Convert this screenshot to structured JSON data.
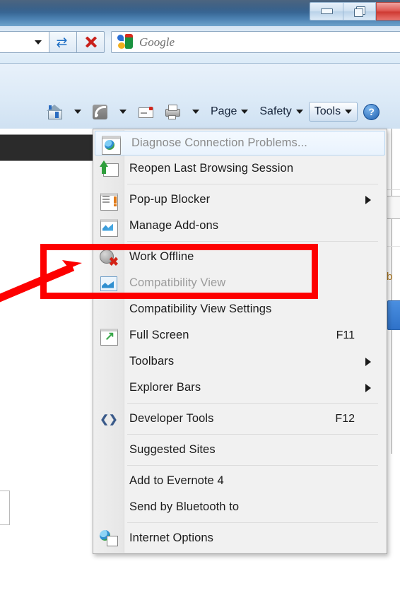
{
  "window": {
    "controls": [
      {
        "name": "minimize",
        "glyph": "minimize"
      },
      {
        "name": "restore",
        "glyph": "restore"
      },
      {
        "name": "close",
        "glyph": "close"
      }
    ]
  },
  "navstrip": {
    "address_dropdown_label": "",
    "refresh_label": "",
    "stop_label": "",
    "search": {
      "placeholder": "Google",
      "value": "",
      "provider": "Google"
    }
  },
  "commandbar": {
    "items": [
      {
        "label": "",
        "icon": "home-icon",
        "has_caret": true
      },
      {
        "label": "",
        "icon": "rss-feeds-icon",
        "has_caret": true
      },
      {
        "label": "",
        "icon": "mail-icon",
        "has_caret": false
      },
      {
        "label": "",
        "icon": "print-icon",
        "has_caret": true
      },
      {
        "label": "Page",
        "icon": "",
        "has_caret": true
      },
      {
        "label": "Safety",
        "icon": "",
        "has_caret": true
      },
      {
        "label": "Tools",
        "icon": "",
        "has_caret": true,
        "pressed": true
      },
      {
        "label": "?",
        "icon": "help-icon",
        "has_caret": false
      }
    ],
    "page_label": "Page",
    "safety_label": "Safety",
    "tools_label": "Tools",
    "help_label": "?"
  },
  "tools_menu": {
    "items": [
      {
        "label": "Diagnose Connection Problems...",
        "icon": "diagnose-icon",
        "accel": "",
        "submenu": false,
        "disabled": true,
        "highlight": true
      },
      {
        "label": "Reopen Last Browsing Session",
        "icon": "reopen-session-icon",
        "accel": "",
        "submenu": false,
        "disabled": false,
        "highlight": false
      },
      {
        "separator": true
      },
      {
        "label": "Pop-up Blocker",
        "icon": "popup-blocker-icon",
        "accel": "",
        "submenu": true,
        "disabled": false,
        "highlight": false
      },
      {
        "label": "Manage Add-ons",
        "icon": "manage-addons-icon",
        "accel": "",
        "submenu": false,
        "disabled": false,
        "highlight": false
      },
      {
        "separator": true
      },
      {
        "label": "Work Offline",
        "icon": "work-offline-icon",
        "accel": "",
        "submenu": false,
        "disabled": false,
        "highlight": false
      },
      {
        "label": "Compatibility View",
        "icon": "compatibility-view-icon",
        "accel": "",
        "submenu": false,
        "disabled": true,
        "highlight": false
      },
      {
        "label": "Compatibility View Settings",
        "icon": "",
        "accel": "",
        "submenu": false,
        "disabled": false,
        "highlight": false
      },
      {
        "label": "Full Screen",
        "icon": "full-screen-icon",
        "accel": "F11",
        "submenu": false,
        "disabled": false,
        "highlight": false
      },
      {
        "label": "Toolbars",
        "icon": "",
        "accel": "",
        "submenu": true,
        "disabled": false,
        "highlight": false
      },
      {
        "label": "Explorer Bars",
        "icon": "",
        "accel": "",
        "submenu": true,
        "disabled": false,
        "highlight": false
      },
      {
        "separator": true
      },
      {
        "label": "Developer Tools",
        "icon": "developer-tools-icon",
        "accel": "F12",
        "submenu": false,
        "disabled": false,
        "highlight": false
      },
      {
        "separator": true
      },
      {
        "label": "Suggested Sites",
        "icon": "",
        "accel": "",
        "submenu": false,
        "disabled": false,
        "highlight": false
      },
      {
        "separator": true
      },
      {
        "label": "Add to Evernote 4",
        "icon": "",
        "accel": "",
        "submenu": false,
        "disabled": false,
        "highlight": false
      },
      {
        "label": "Send by Bluetooth to",
        "icon": "",
        "accel": "",
        "submenu": false,
        "disabled": false,
        "highlight": false
      },
      {
        "separator": true
      },
      {
        "label": "Internet Options",
        "icon": "internet-options-icon",
        "accel": "",
        "submenu": false,
        "disabled": false,
        "highlight": false
      }
    ]
  },
  "annotation": {
    "color": "#fd0000",
    "highlight_rect_targets": [
      "Work Offline",
      "Compatibility View"
    ],
    "arrow_direction": "up-right"
  },
  "background": {
    "text_fragment": "b"
  }
}
